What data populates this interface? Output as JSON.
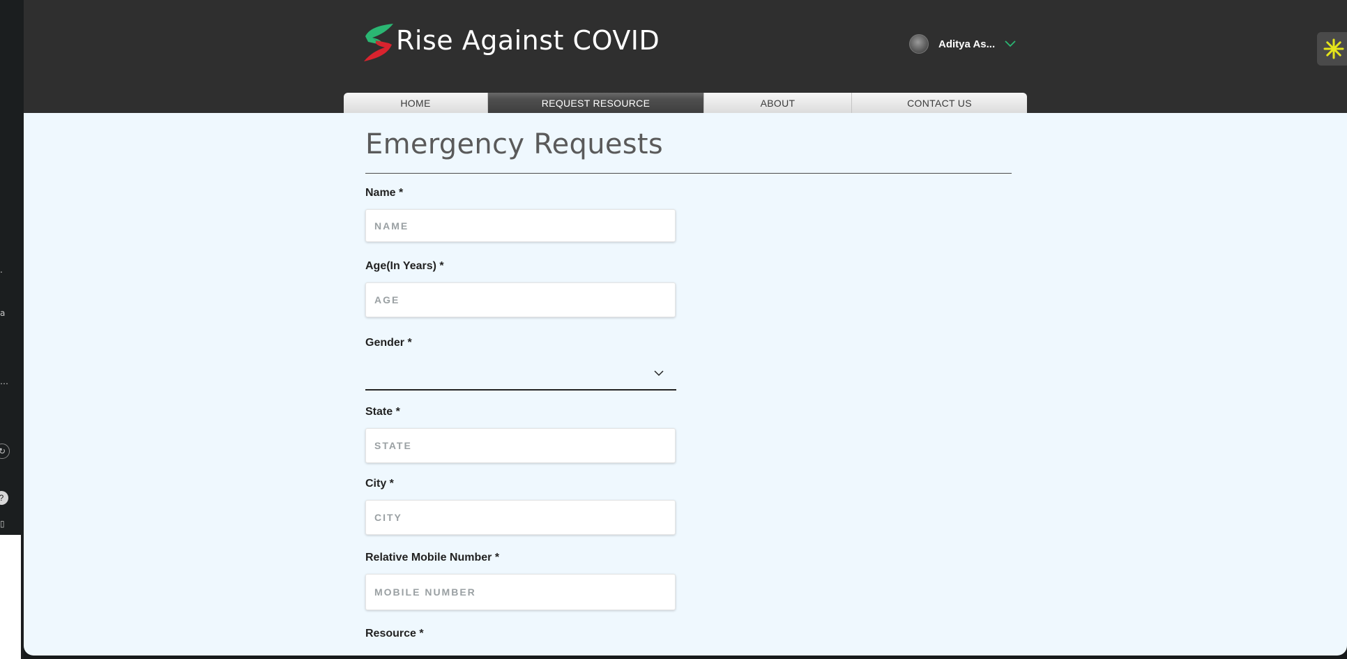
{
  "site": {
    "title": "Rise Against COVID"
  },
  "user": {
    "name": "Aditya As..."
  },
  "nav": {
    "items": [
      {
        "label": "HOME",
        "active": false
      },
      {
        "label": "REQUEST RESOURCE",
        "active": true
      },
      {
        "label": "ABOUT",
        "active": false
      },
      {
        "label": "CONTACT US",
        "active": false
      }
    ]
  },
  "form": {
    "title": "Emergency Requests",
    "name": {
      "label": "Name *",
      "placeholder": "NAME"
    },
    "age": {
      "label": "Age(In Years) *",
      "placeholder": "AGE"
    },
    "gender": {
      "label": "Gender *",
      "value": ""
    },
    "state": {
      "label": "State *",
      "placeholder": "STATE"
    },
    "city": {
      "label": "City *",
      "placeholder": "CITY"
    },
    "mobile": {
      "label": "Relative Mobile Number *",
      "placeholder": "MOBILE NUMBER"
    },
    "resource": {
      "label": "Resource *"
    }
  },
  "colors": {
    "header_bg": "#2f2f2f",
    "content_bg": "#eff8fe",
    "accent_green": "#2bb673",
    "accent_red": "#d9232e",
    "widget_yellow": "#e5e51a"
  }
}
